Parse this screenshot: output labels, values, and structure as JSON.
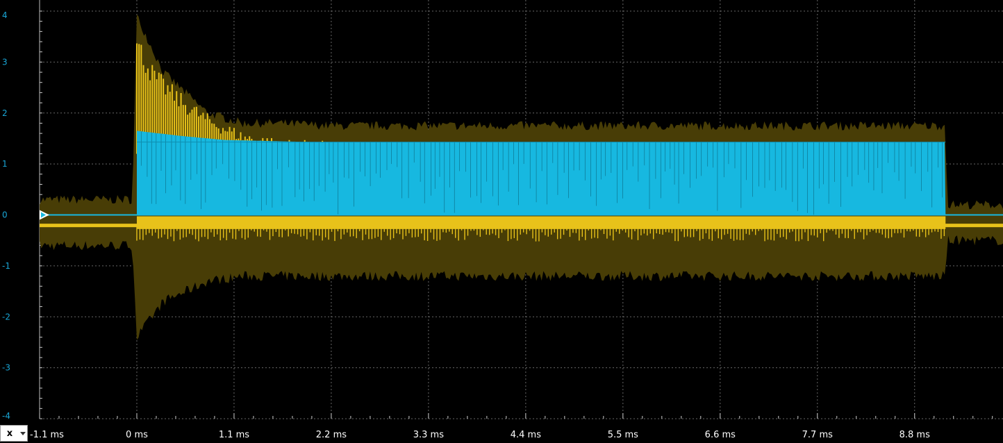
{
  "chart_data": {
    "type": "line",
    "xlabel": "",
    "ylabel": "",
    "x_ticks": [
      "-1.1 ms",
      "0 ms",
      "1.1 ms",
      "2.2 ms",
      "3.3 ms",
      "4.4 ms",
      "5.5 ms",
      "6.6 ms",
      "7.7 ms",
      "8.8 ms"
    ],
    "y_ticks": [
      "4",
      "3",
      "2",
      "1",
      "0",
      "-1",
      "-2",
      "-3",
      "-4"
    ],
    "xlim": [
      -1.1,
      9.8
    ],
    "ylim": [
      -4,
      4
    ],
    "grid": true,
    "series": [
      {
        "color": "#e8c21a",
        "envelope_color": "#483d06",
        "envelope_upper": [
          [
            -1.1,
            0.3
          ],
          [
            -0.05,
            0.3
          ],
          [
            0.0,
            3.9
          ],
          [
            0.3,
            2.8
          ],
          [
            0.8,
            2.0
          ],
          [
            1.2,
            1.8
          ],
          [
            1.6,
            1.8
          ],
          [
            2.2,
            1.75
          ],
          [
            4.4,
            1.75
          ],
          [
            6.6,
            1.75
          ],
          [
            8.8,
            1.75
          ],
          [
            9.15,
            1.75
          ],
          [
            9.17,
            0.2
          ],
          [
            9.8,
            0.2
          ]
        ],
        "envelope_lower": [
          [
            -1.1,
            -0.6
          ],
          [
            -0.05,
            -0.6
          ],
          [
            0.0,
            -2.4
          ],
          [
            0.3,
            -1.7
          ],
          [
            0.8,
            -1.3
          ],
          [
            1.2,
            -1.2
          ],
          [
            2.2,
            -1.2
          ],
          [
            4.4,
            -1.2
          ],
          [
            6.6,
            -1.2
          ],
          [
            8.8,
            -1.2
          ],
          [
            9.15,
            -1.2
          ],
          [
            9.17,
            -0.5
          ],
          [
            9.8,
            -0.5
          ]
        ],
        "peak_decay": [
          [
            0.0,
            3.6
          ],
          [
            0.2,
            2.9
          ],
          [
            0.5,
            2.4
          ],
          [
            0.8,
            2.0
          ],
          [
            1.2,
            1.65
          ],
          [
            1.6,
            1.5
          ],
          [
            2.2,
            1.45
          ]
        ],
        "baseline": -0.2
      },
      {
        "color": "#17b8e0",
        "burst_start": 0.0,
        "burst_end": 9.15,
        "top": [
          [
            0.0,
            1.65
          ],
          [
            0.5,
            1.55
          ],
          [
            1.0,
            1.47
          ],
          [
            2.0,
            1.43
          ],
          [
            9.15,
            1.43
          ]
        ],
        "low": 0.0,
        "baseline": 0.0
      }
    ]
  },
  "channel_marker": {
    "label": ""
  },
  "x_selector": {
    "label": "x"
  },
  "colors": {
    "background": "#000000",
    "grid": "#8a8a8a",
    "ytick_label": "#19a6d6",
    "xtick_label": "#ffffff"
  }
}
